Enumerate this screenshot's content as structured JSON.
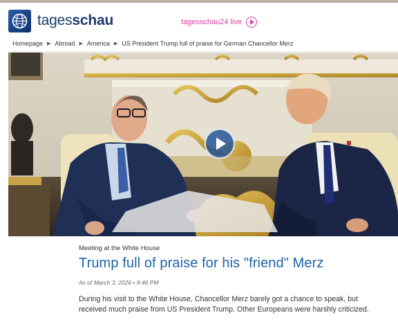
{
  "header": {
    "brand_light": "tages",
    "brand_bold": "schau",
    "live_label": "tagesschau24 live",
    "logo_icon": "tagesschau-globe-logo",
    "accent_color": "#d63fa0",
    "brand_color": "#1d3a6b"
  },
  "breadcrumb": {
    "items": [
      "Homepage",
      "Abroad",
      "America",
      "US President Trump full of praise for German Chancellor Merz"
    ],
    "separator_icon": "triangle-right-icon"
  },
  "hero": {
    "media_icon": "play-icon"
  },
  "article": {
    "kicker": "Meeting at the White House",
    "headline": "Trump full of praise for his \"friend\" Merz",
    "dateline": "As of March 3, 2026 • 9:46 PM",
    "lead": "During his visit to the White House, Chancellor Merz barely got a chance to speak, but received much praise from US President Trump. Other Europeans were harshly criticized.",
    "headline_color": "#1d63a8"
  }
}
